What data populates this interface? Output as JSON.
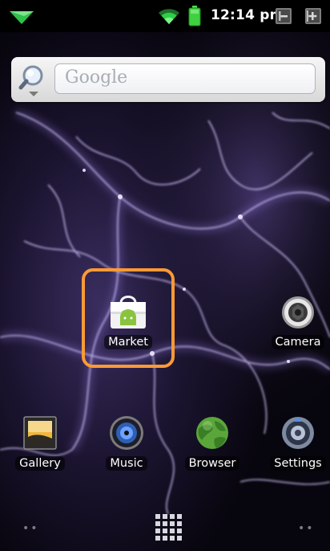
{
  "status_bar": {
    "time": "12:14 pm",
    "icons": [
      "notification-arrow-icon",
      "wifi-icon",
      "battery-icon",
      "volume-down-icon",
      "volume-up-icon"
    ]
  },
  "search_widget": {
    "placeholder": "Google",
    "icon": "search-magnifier-icon"
  },
  "home_apps": [
    {
      "label": "Market",
      "icon": "market-bag-icon"
    },
    {
      "label": "Camera",
      "icon": "camera-icon"
    }
  ],
  "dock_apps": [
    {
      "label": "Gallery",
      "icon": "gallery-icon"
    },
    {
      "label": "Music",
      "icon": "music-icon"
    },
    {
      "label": "Browser",
      "icon": "browser-globe-icon"
    },
    {
      "label": "Settings",
      "icon": "settings-icon"
    }
  ],
  "bottom_bar": {
    "left_dots": "••",
    "right_dots": "••",
    "launcher_icon": "app-drawer-grid-icon"
  },
  "colors": {
    "highlight": "#ff9a35",
    "wallpaper_glow": "#b9a2ff",
    "status_bar": "#000000"
  }
}
